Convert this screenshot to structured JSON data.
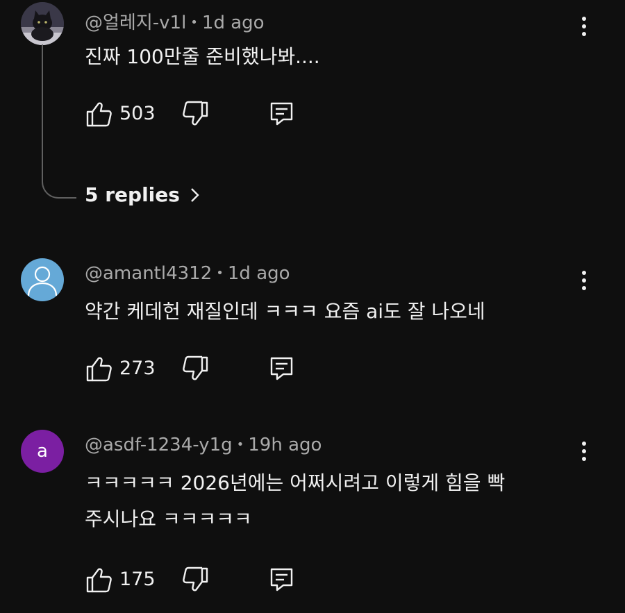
{
  "comments": [
    {
      "author": "@얼레지-v1l",
      "time": "1d ago",
      "text_lines": [
        "진짜 100만줄 준비했나봐...."
      ],
      "likes": "503",
      "avatar_type": "photo-cat",
      "replies_label": "5 replies"
    },
    {
      "author": "@amantl4312",
      "time": "1d ago",
      "text_lines": [
        "약간 케데헌 재질인데 ㅋㅋㅋ 요즘 ai도 잘 나오네"
      ],
      "likes": "273",
      "avatar_type": "default-person"
    },
    {
      "author": "@asdf-1234-y1g",
      "time": "19h ago",
      "text_lines": [
        "ㅋㅋㅋㅋㅋ 2026년에는 어쩌시려고 이렇게 힘을 빡",
        "주시나요 ㅋㅋㅋㅋㅋ"
      ],
      "likes": "175",
      "avatar_type": "letter",
      "avatar_letter": "a"
    }
  ],
  "dot": "•",
  "icons": {
    "like": "thumbs-up-icon",
    "dislike": "thumbs-down-icon",
    "reply": "reply-comment-icon",
    "more": "more-vert-icon",
    "chevron": "chevron-right-icon"
  },
  "colors": {
    "background": "#0f0f0f",
    "primary_text": "#f1f1f1",
    "secondary_text": "#aaaaaa",
    "avatar_default": "#65a9d7",
    "avatar_letter_bg": "#7b1fa2"
  }
}
